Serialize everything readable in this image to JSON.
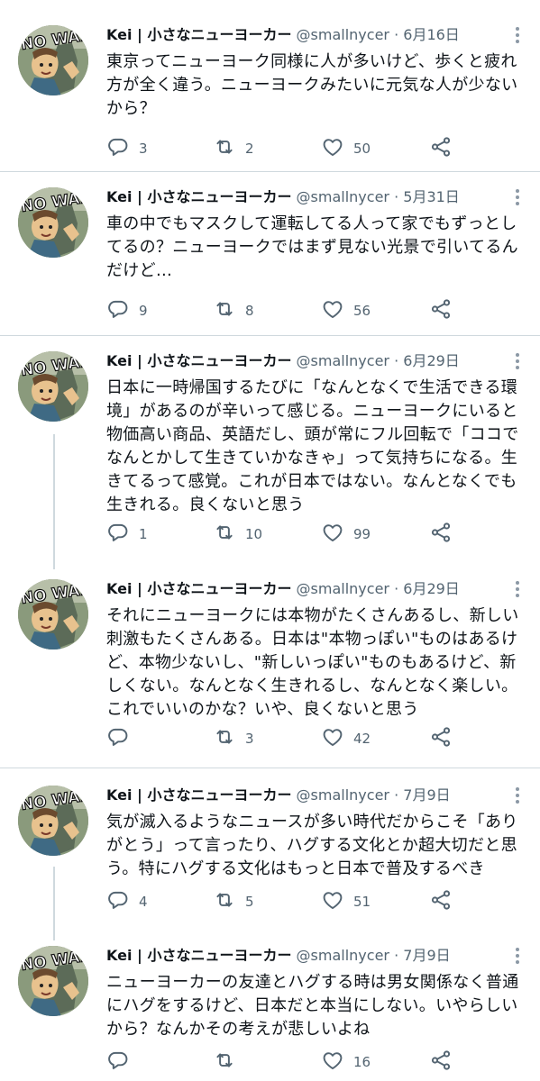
{
  "colors": {
    "text": "#0f1419",
    "muted": "#536471",
    "divider": "#cfd9de",
    "icon": "#536471"
  },
  "avatar": {
    "text": "NO WAR"
  },
  "tweets": [
    {
      "name": "Kei | 小さなニューヨーカー",
      "handle": "@smallnycer",
      "date": "6月16日",
      "text": "東京ってニューヨーク同様に人が多いけど、歩くと疲れ\n方が全く違う。ニューヨークみたいに元気な人が少ない\nから？",
      "replies": "3",
      "retweets": "2",
      "likes": "50"
    },
    {
      "name": "Kei | 小さなニューヨーカー",
      "handle": "@smallnycer",
      "date": "5月31日",
      "text": "車の中でもマスクして運転してる人って家でもずっとし\nてるの？ニューヨークではまず見ない光景で引いてるん\nだけど…",
      "replies": "9",
      "retweets": "8",
      "likes": "56"
    },
    {
      "name": "Kei | 小さなニューヨーカー",
      "handle": "@smallnycer",
      "date": "6月29日",
      "text": "日本に一時帰国するたびに「なんとなくで生活できる環\n境」があるのが辛いって感じる。ニューヨークにいると\n物価高い商品、英語だし、頭が常にフル回転で「ココで\nなんとかして生きていかなきゃ」って気持ちになる。生\nきてるって感覚。これが日本ではない。なんとなくでも\n生きれる。良くないと思う",
      "replies": "1",
      "retweets": "10",
      "likes": "99"
    },
    {
      "name": "Kei | 小さなニューヨーカー",
      "handle": "@smallnycer",
      "date": "6月29日",
      "text": "それにニューヨークには本物がたくさんあるし、新しい\n刺激もたくさんある。日本は\"本物っぽい\"ものはあるけ\nど、本物少ないし、\"新しいっぽい\"ものもあるけど、新\nしくない。なんとなく生きれるし、なんとなく楽しい。\nこれでいいのかな？いや、良くないと思う",
      "replies": "",
      "retweets": "3",
      "likes": "42"
    },
    {
      "name": "Kei | 小さなニューヨーカー",
      "handle": "@smallnycer",
      "date": "7月9日",
      "text": "気が滅入るようなニュースが多い時代だからこそ「あり\nがとう」って言ったり、ハグする文化とか超大切だと思\nう。特にハグする文化はもっと日本で普及するべき",
      "replies": "4",
      "retweets": "5",
      "likes": "51"
    },
    {
      "name": "Kei | 小さなニューヨーカー",
      "handle": "@smallnycer",
      "date": "7月9日",
      "text": "ニューヨーカーの友達とハグする時は男女関係なく普通\nにハグをするけど、日本だと本当にしない。いやらしい\nから？なんかその考えが悲しいよね",
      "replies": "",
      "retweets": "",
      "likes": "16"
    }
  ]
}
